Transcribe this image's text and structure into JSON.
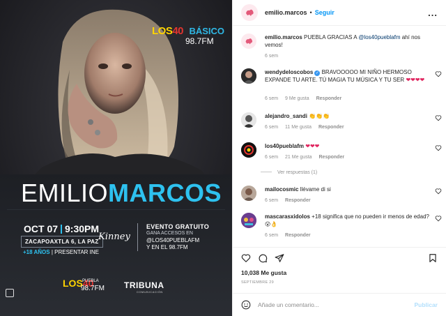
{
  "post": {
    "poster": {
      "brand_los": "LOS",
      "brand_40": "40",
      "brand_basico": "BÁSICO",
      "brand_freq": "98.7FM",
      "artist_first": "EMILIO",
      "artist_last": "MARCOS",
      "date": "OCT 07",
      "time": "9:30PM",
      "venue": "ZACAPOAXTLA 6, LA PAZ",
      "age_bold": "+18 AÑOS",
      "age_rest": "| PRESENTAR INE",
      "venue_logo": "Kinney",
      "event_title": "EVENTO GRATUITO",
      "event_line1": "GANA ACCESOS EN",
      "event_line2": "@LOS40PUEBLAFM",
      "event_line3": "Y EN EL 98.7FM",
      "footer_los": "LOS",
      "footer_40": "40",
      "footer_puebla": "PUEBLA",
      "footer_freq": "98.7FM",
      "tribuna": "TRIBUNA",
      "tribuna_sub": "COMUNICACIÓN"
    }
  },
  "header": {
    "username": "emilio.marcos",
    "dot": "•",
    "follow_label": "Seguir",
    "more_label": "..."
  },
  "caption": {
    "username": "emilio.marcos",
    "text_before": "PUEBLA GRACIAS A",
    "mention": "@los40pueblafm",
    "text_after": "ahí nos vemos!",
    "time": "6 sem"
  },
  "comments": [
    {
      "username": "wendydeloscobos",
      "verified": true,
      "text": "BRAVOOOOO MI NIÑO HERMOSO EXPANDE TU ARTE. TÚ MAGIA TU MÚSICA Y TU SER",
      "emoji": "❤❤❤❤",
      "time": "6 sem",
      "likes": "9 Me gusta",
      "reply": "Responder"
    },
    {
      "username": "alejandro_sandi",
      "verified": false,
      "text": "",
      "emoji": "👏👏👏",
      "time": "6 sem",
      "likes": "11 Me gusta",
      "reply": "Responder"
    },
    {
      "username": "los40pueblafm",
      "verified": false,
      "text": "",
      "emoji": "❤❤❤",
      "time": "6 sem",
      "likes": "21 Me gusta",
      "reply": "Responder",
      "view_replies": "Ver respuestas (1)"
    },
    {
      "username": "mailocosmic",
      "verified": false,
      "text": "llévame di si",
      "emoji": "",
      "time": "6 sem",
      "likes": "",
      "reply": "Responder"
    },
    {
      "username": "mascarasxidolos",
      "verified": false,
      "text": "+18 significa que no pueden ir menos de edad?",
      "emoji": "😮👌",
      "time": "6 sem",
      "likes": "",
      "reply": "Responder"
    }
  ],
  "stats": {
    "likes": "10,038 Me gusta",
    "date": "SEPTIEMBRE 29"
  },
  "add_comment": {
    "placeholder": "Añade un comentario...",
    "publish_label": "Publicar"
  },
  "colors": {
    "accent": "#0095f6",
    "heart": "#e0245e",
    "poster_blue": "#2ec1ef"
  }
}
